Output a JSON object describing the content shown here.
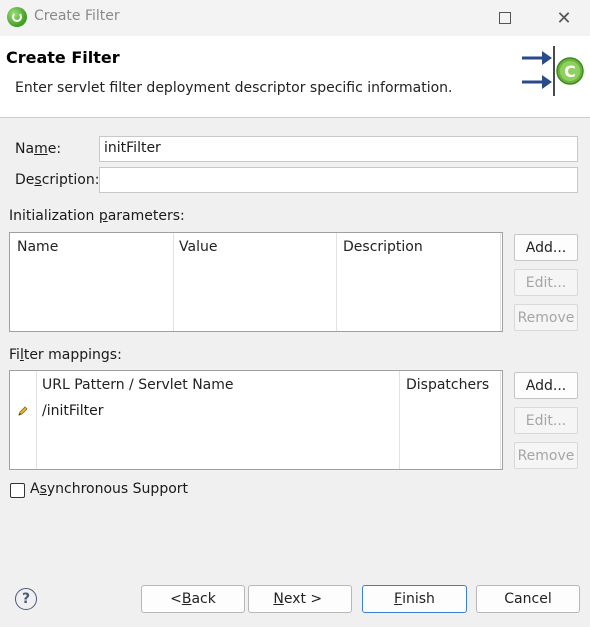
{
  "window": {
    "title": "Create Filter",
    "maximize_icon": "maximize-icon",
    "close_glyph": "✕"
  },
  "banner": {
    "title": "Create Filter",
    "subtitle": "Enter servlet filter deployment descriptor specific information."
  },
  "form": {
    "name_label_pre": "Na",
    "name_label_u": "m",
    "name_label_post": "e:",
    "name_value": "initFilter",
    "description_label_pre": "De",
    "description_label_u": "s",
    "description_label_post": "cription:",
    "description_value": ""
  },
  "init_params": {
    "label_pre": "Initialization ",
    "label_u": "p",
    "label_post": "arameters:",
    "columns": [
      "Name",
      "Value",
      "Description"
    ],
    "rows": [],
    "add_label": "Add...",
    "edit_label": "Edit...",
    "remove_label": "Remove"
  },
  "filter_mappings": {
    "label_pre": "Fi",
    "label_u": "l",
    "label_post": "ter mappings:",
    "columns": [
      "URL Pattern / Servlet Name",
      "Dispatchers"
    ],
    "rows": [
      {
        "icon": "pencil-icon",
        "pattern": "/initFilter",
        "dispatchers": ""
      }
    ],
    "add_label": "Add...",
    "edit_label": "Edit...",
    "remove_label": "Remove"
  },
  "async": {
    "label_pre": "A",
    "label_u": "s",
    "label_post": "ynchronous Support",
    "checked": false
  },
  "footer": {
    "help_glyph": "?",
    "back_pre": "< ",
    "back_u": "B",
    "back_post": "ack",
    "next_u": "N",
    "next_post": "ext >",
    "finish_u": "F",
    "finish_post": "inish",
    "cancel_label": "Cancel"
  },
  "colors": {
    "primary_button_border": "#3b7fd6",
    "spring_green": "#6ab43e"
  }
}
